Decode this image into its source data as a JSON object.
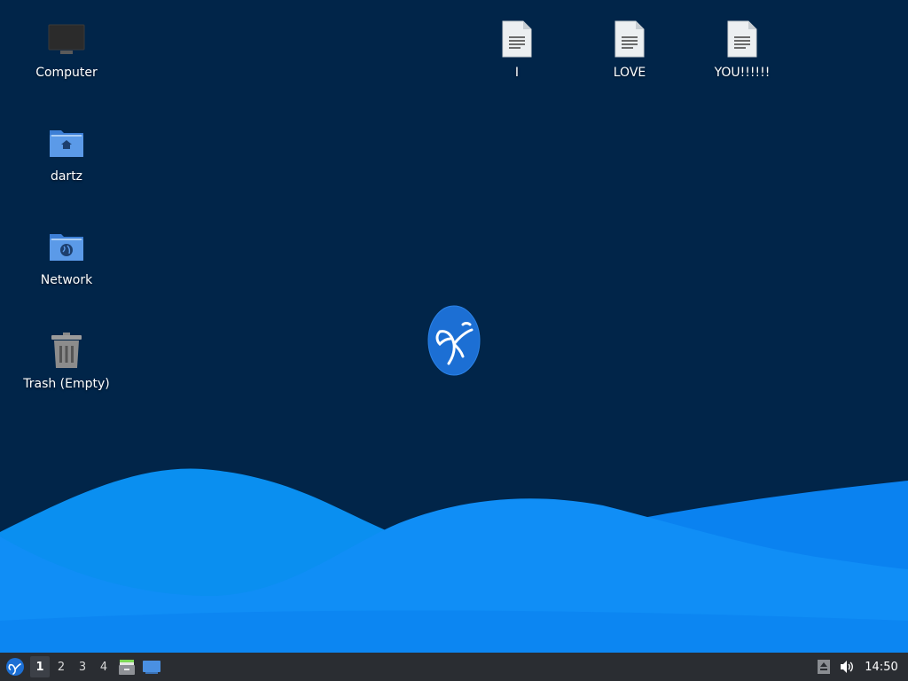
{
  "desktop": {
    "background_color": "#012549",
    "icons": [
      {
        "label": "Computer",
        "icon": "computer-icon"
      },
      {
        "label": "dartz",
        "icon": "home-folder-icon"
      },
      {
        "label": "Network",
        "icon": "network-folder-icon"
      },
      {
        "label": "Trash (Empty)",
        "icon": "trash-icon"
      },
      {
        "label": "I",
        "icon": "text-file-icon"
      },
      {
        "label": "LOVE",
        "icon": "text-file-icon"
      },
      {
        "label": "YOU!!!!!!",
        "icon": "text-file-icon"
      }
    ],
    "wave_colors": [
      "#0a8ff0",
      "#108ef6",
      "#0678ea",
      "#0a82f0"
    ],
    "logo": "hummingbird-logo-icon",
    "logo_color": "#1c6fd4"
  },
  "taskbar": {
    "background_color": "#2a2d32",
    "start_icon": "hummingbird-menu-icon",
    "workspaces": [
      "1",
      "2",
      "3",
      "4"
    ],
    "active_workspace": "1",
    "launchers": [
      {
        "icon": "file-manager-icon"
      },
      {
        "icon": "show-desktop-icon"
      }
    ],
    "tray": [
      {
        "icon": "eject-icon"
      },
      {
        "icon": "volume-icon"
      }
    ],
    "clock": "14:50"
  }
}
